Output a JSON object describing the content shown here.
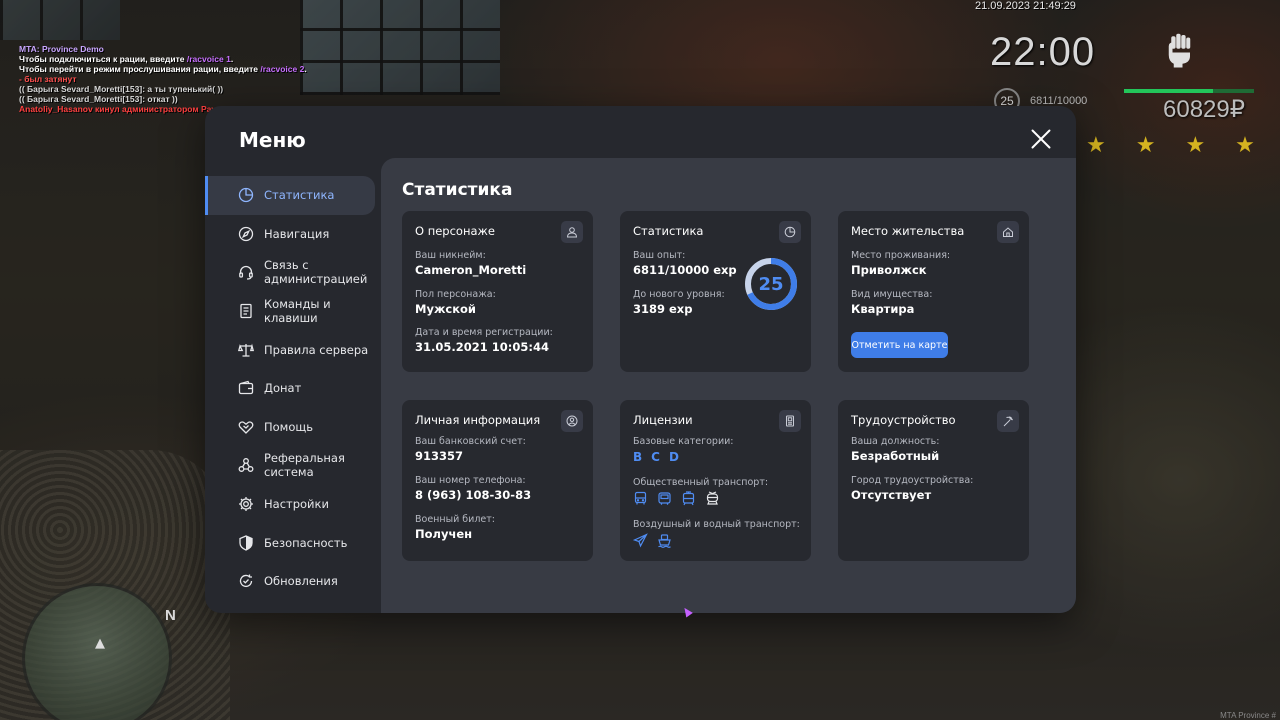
{
  "hud": {
    "date": "21.09.2023 21:49:29",
    "time": "22:00",
    "level": "25",
    "exp": "6811/10000",
    "money": "60829₽",
    "stars": "★★★★",
    "exp_fill": 0.6811,
    "minimap_north": "N",
    "watermark": "MTA Province #",
    "chat": {
      "line1": "MTA: Province Demo",
      "line2_text": "Чтобы подключиться к рации, введите ",
      "line2_cmd": "/racvoice 1",
      "line2_end": ".",
      "line3_text": "Чтобы перейти в режим прослушивания рации, введите ",
      "line3_cmd": "/racvoice 2",
      "line3_end": ".",
      "line4": "- был затянут",
      "line5": "(( Барыга Sevard_Moretti[153]: а ты тупенький( ))",
      "line6": "(( Барыга Sevard_Moretti[153]: откат ))",
      "line7": "Anatoliy_Hasanov кинул администратором Pavel_Morello (лаги)"
    }
  },
  "menu": {
    "title": "Меню",
    "sidebar": [
      {
        "label": "Статистика",
        "icon": "pie-chart-icon",
        "active": true
      },
      {
        "label": "Навигация",
        "icon": "compass-icon"
      },
      {
        "label": "Связь с администрацией",
        "icon": "headset-icon"
      },
      {
        "label": "Команды и клавиши",
        "icon": "document-icon"
      },
      {
        "label": "Правила сервера",
        "icon": "scales-icon"
      },
      {
        "label": "Донат",
        "icon": "wallet-icon"
      },
      {
        "label": "Помощь",
        "icon": "handshake-icon"
      },
      {
        "label": "Реферальная система",
        "icon": "referral-icon"
      },
      {
        "label": "Настройки",
        "icon": "gear-icon"
      },
      {
        "label": "Безопасность",
        "icon": "shield-icon"
      },
      {
        "label": "Обновления",
        "icon": "refresh-check-icon"
      }
    ],
    "content_title": "Статистика",
    "cards": {
      "character": {
        "title": "О персонаже",
        "nickname_label": "Ваш никнейм:",
        "nickname": "Cameron_Moretti",
        "gender_label": "Пол персонажа:",
        "gender": "Мужской",
        "reg_label": "Дата и время регистрации:",
        "reg": "31.05.2021 10:05:44"
      },
      "stats": {
        "title": "Статистика",
        "exp_label": "Ваш опыт:",
        "exp": "6811/10000 exp",
        "next_label": "До нового уровня:",
        "next": "3189 exp",
        "level": "25",
        "level_progress": 0.6811
      },
      "residence": {
        "title": "Место жительства",
        "city_label": "Место проживания:",
        "city": "Приволжск",
        "property_label": "Вид имущества:",
        "property": "Квартира",
        "button": "Отметить на карте"
      },
      "personal": {
        "title": "Личная информация",
        "bank_label": "Ваш банковский счет:",
        "bank": "913357",
        "phone_label": "Ваш номер телефона:",
        "phone": "8 (963) 108-30-83",
        "military_label": "Военный билет:",
        "military": "Получен"
      },
      "licenses": {
        "title": "Лицензии",
        "base_label": "Базовые категории:",
        "categories": [
          "B",
          "C",
          "D"
        ],
        "public_label": "Общественный транспорт:",
        "public_icons": [
          "bus-icon",
          "bus-front-icon",
          "tram-icon",
          "trolleybus-icon"
        ],
        "air_label": "Воздушный и водный транспорт:",
        "air_icons": [
          "airplane-icon",
          "boat-icon"
        ]
      },
      "employment": {
        "title": "Трудоустройство",
        "position_label": "Ваша должность:",
        "position": "Безработный",
        "city_label": "Город трудоустройства:",
        "city": "Отсутствует"
      }
    }
  }
}
